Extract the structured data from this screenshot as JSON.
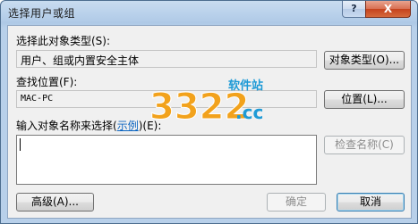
{
  "window": {
    "title": "选择用户或组",
    "help_glyph": "?",
    "close_glyph": "X"
  },
  "object_type": {
    "label": "选择此对象类型(S):",
    "value": "用户、组或内置安全主体",
    "button": "对象类型(O)..."
  },
  "location": {
    "label": "查找位置(F):",
    "value": "MAC-PC",
    "button": "位置(L)..."
  },
  "names": {
    "label_before": "输入对象名称来选择(",
    "examples_link": "示例",
    "label_after": ")(E):",
    "value": "",
    "check_button": "检查名称(C)"
  },
  "footer": {
    "advanced_button": "高级(A)...",
    "ok_button": "确定",
    "cancel_button": "取消"
  },
  "watermark": {
    "number": "3322",
    "suffix": ".cc",
    "site": "软件站"
  }
}
